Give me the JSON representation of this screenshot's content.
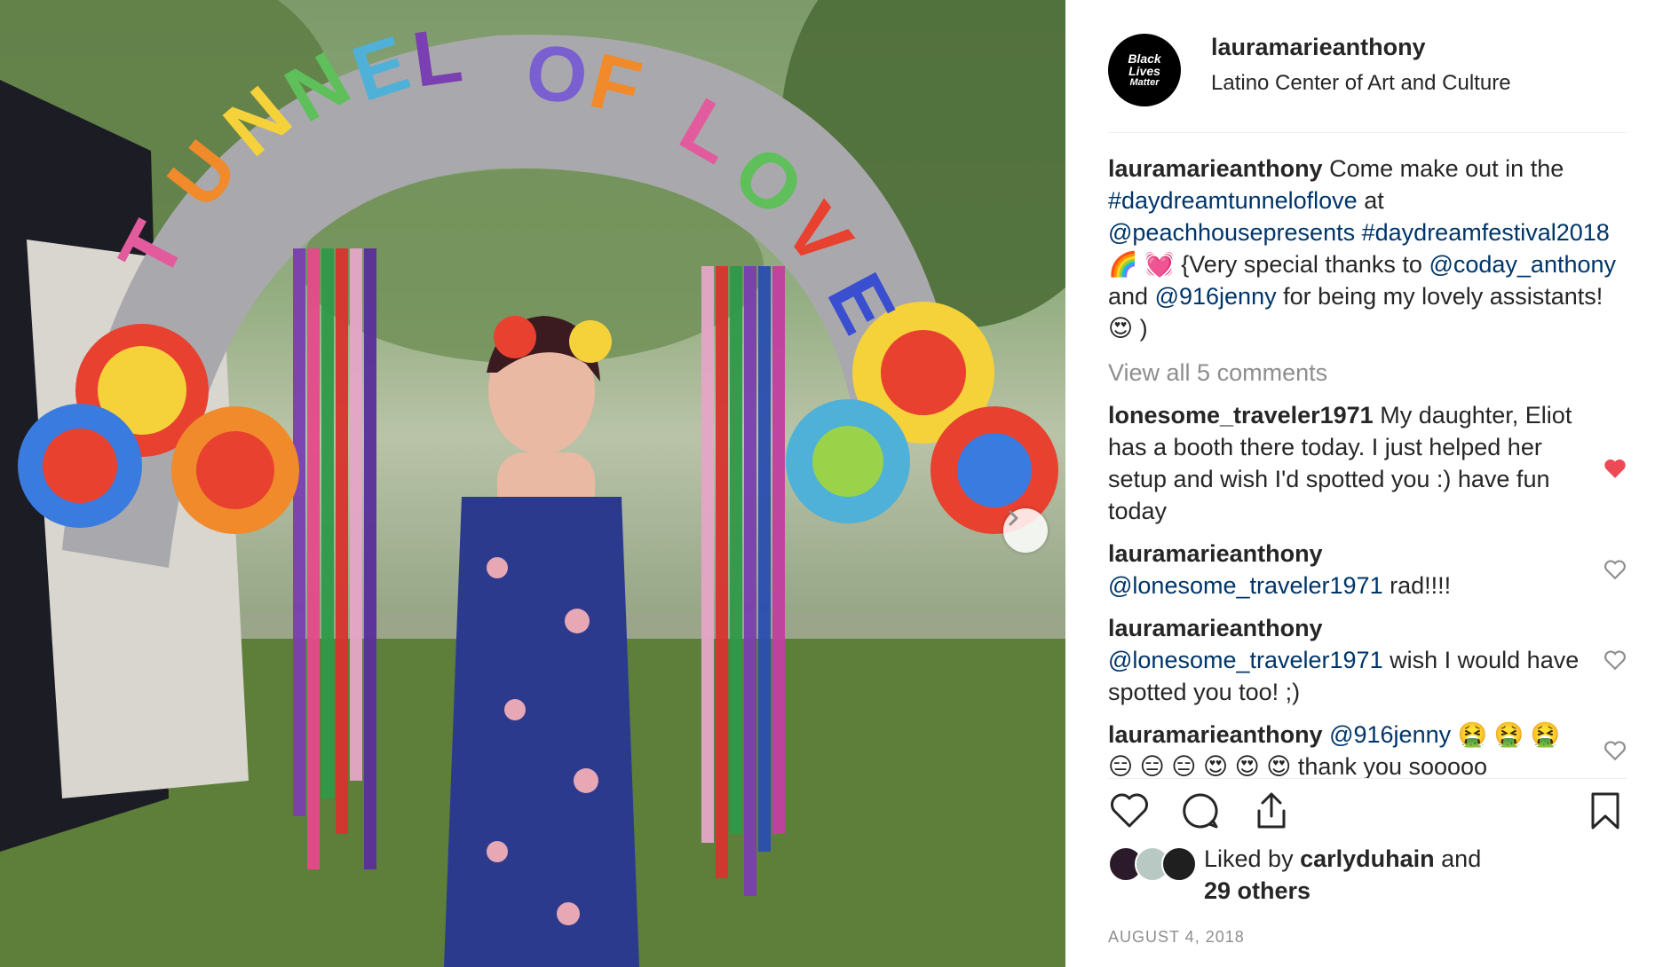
{
  "post": {
    "image_alt": "Woman under a Tunnel of Love arch",
    "arch_text": "TUNNEL OF LOVE"
  },
  "header": {
    "avatar_lines": [
      "Black",
      "Lives",
      "Matter"
    ],
    "username": "lauramarieanthony",
    "location": "Latino Center of Art and Culture"
  },
  "caption": {
    "username": "lauramarieanthony",
    "text_1": "Come make out in the",
    "hashtag_1": "#daydreamtunneloflove",
    "text_2": "at",
    "mention_1": "@peachhousepresents",
    "hashtag_2": "#daydreamfestival2018",
    "emoji_1": "🌈 💓",
    "text_3": "{Very special thanks to",
    "mention_2": "@coday_anthony",
    "text_4": "and",
    "mention_3": "@916jenny",
    "text_5": "for being my lovely assistants! 😍 )"
  },
  "view_all": "View all 5 comments",
  "comments": [
    {
      "username": "lonesome_traveler1971",
      "text": "My daughter, Eliot has a booth there today. I just helped her setup and wish I'd spotted you :) have fun today",
      "liked": true
    },
    {
      "username": "lauramarieanthony",
      "mention": "@lonesome_traveler1971",
      "text": "rad!!!!",
      "liked": false
    },
    {
      "username": "lauramarieanthony",
      "mention": "@lonesome_traveler1971",
      "text": "wish I would have spotted you too! ;)",
      "liked": false
    },
    {
      "username": "lauramarieanthony",
      "mention": "@916jenny",
      "text": "🤮 🤮 🤮 😑 😑 😑 😍 😍 😍 thank you sooooo",
      "liked": false
    }
  ],
  "likes": {
    "prefix": "Liked by",
    "user": "carlyduhain",
    "and": "and",
    "others": "29 others"
  },
  "date": "AUGUST 4, 2018",
  "colors": {
    "link": "#003569",
    "heart_liked": "#ed4956",
    "muted": "#8e8e8e"
  },
  "icons": [
    "heart-icon",
    "comment-icon",
    "share-icon",
    "bookmark-icon",
    "chevron-right-icon"
  ]
}
